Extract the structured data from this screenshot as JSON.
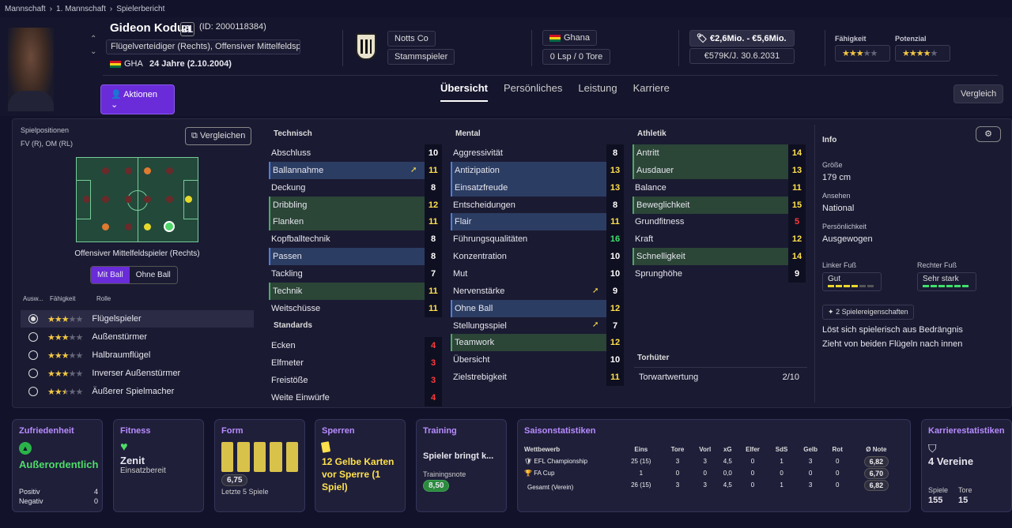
{
  "breadcrumb": [
    "Mannschaft",
    "1. Mannschaft",
    "Spielerbericht"
  ],
  "player": {
    "name": "Gideon Kodua",
    "number": "21",
    "id": "(ID: 2000118384)",
    "positions": "Flügelverteidiger (Rechts), Offensiver Mittelfeldsp...",
    "nation": "GHA",
    "age": "24 Jahre (2.10.2004)"
  },
  "club": {
    "name": "Notts Co",
    "role": "Stammspieler"
  },
  "country": {
    "name": "Ghana",
    "caps": "0 Lsp / 0 Tore"
  },
  "value": {
    "range": "€2,6Mio. - €5,6Mio.",
    "contract": "€579K/J. 30.6.2031"
  },
  "ability": {
    "label": "Fähigkeit",
    "stars": 2.5,
    "potential_label": "Potenzial",
    "potential_stars": 4
  },
  "actions_label": "Aktionen",
  "tabs": [
    "Übersicht",
    "Persönliches",
    "Leistung",
    "Karriere"
  ],
  "compare_label": "Vergleich",
  "positions_panel": {
    "title": "Spielpositionen",
    "value": "FV (R), OM (RL)",
    "compare_btn": "Vergleichen",
    "role_name": "Offensiver Mittelfeldspieler (Rechts)",
    "with_ball": "Mit Ball",
    "without_ball": "Ohne Ball",
    "col_select": "Ausw...",
    "col_ability": "Fähigkeit",
    "col_role": "Rolle",
    "roles": [
      {
        "name": "Flügelspieler",
        "stars": 3,
        "selected": true
      },
      {
        "name": "Außenstürmer",
        "stars": 3
      },
      {
        "name": "Halbraumflügel",
        "stars": 3
      },
      {
        "name": "Inverser Außenstürmer",
        "stars": 3
      },
      {
        "name": "Äußerer Spielmacher",
        "stars": 2.5
      }
    ]
  },
  "technical": {
    "title": "Technisch",
    "rows": [
      [
        "Abschluss",
        "10",
        ""
      ],
      [
        "Ballannahme",
        "11",
        "blue"
      ],
      [
        "Deckung",
        "8",
        ""
      ],
      [
        "Dribbling",
        "12",
        "green"
      ],
      [
        "Flanken",
        "11",
        "green"
      ],
      [
        "Kopfballtechnik",
        "8",
        ""
      ],
      [
        "Passen",
        "8",
        "blue"
      ],
      [
        "Tackling",
        "7",
        ""
      ],
      [
        "Technik",
        "11",
        "green"
      ],
      [
        "Weitschüsse",
        "11",
        ""
      ]
    ]
  },
  "standards": {
    "title": "Standards",
    "rows": [
      [
        "Ecken",
        "4",
        ""
      ],
      [
        "Elfmeter",
        "3",
        ""
      ],
      [
        "Freistöße",
        "3",
        ""
      ],
      [
        "Weite Einwürfe",
        "4",
        ""
      ]
    ]
  },
  "mental": {
    "title": "Mental",
    "rows": [
      [
        "Aggressivität",
        "8",
        ""
      ],
      [
        "Antizipation",
        "13",
        "blue"
      ],
      [
        "Einsatzfreude",
        "13",
        "blue"
      ],
      [
        "Entscheidungen",
        "8",
        ""
      ],
      [
        "Flair",
        "11",
        "blue"
      ],
      [
        "Führungsqualitäten",
        "16",
        ""
      ],
      [
        "Konzentration",
        "10",
        ""
      ],
      [
        "Mut",
        "10",
        ""
      ],
      [
        "Nervenstärke",
        "9",
        ""
      ],
      [
        "Ohne Ball",
        "12",
        "blue"
      ],
      [
        "Stellungsspiel",
        "7",
        ""
      ],
      [
        "Teamwork",
        "12",
        "green"
      ],
      [
        "Übersicht",
        "10",
        ""
      ],
      [
        "Zielstrebigkeit",
        "11",
        ""
      ]
    ]
  },
  "athletic": {
    "title": "Athletik",
    "rows": [
      [
        "Antritt",
        "14",
        "green"
      ],
      [
        "Ausdauer",
        "13",
        "green"
      ],
      [
        "Balance",
        "11",
        ""
      ],
      [
        "Beweglichkeit",
        "15",
        "green"
      ],
      [
        "Grundfitness",
        "5",
        ""
      ],
      [
        "Kraft",
        "12",
        ""
      ],
      [
        "Schnelligkeit",
        "14",
        "green"
      ],
      [
        "Sprunghöhe",
        "9",
        ""
      ]
    ]
  },
  "keeper": {
    "title": "Torhüter",
    "label": "Torwartwertung",
    "value": "2/10"
  },
  "info": {
    "title": "Info",
    "height_label": "Größe",
    "height": "179 cm",
    "reputation_label": "Ansehen",
    "reputation": "National",
    "personality_label": "Persönlichkeit",
    "personality": "Ausgewogen",
    "left_foot_label": "Linker Fuß",
    "left_foot": "Gut",
    "right_foot_label": "Rechter Fuß",
    "right_foot": "Sehr stark",
    "traits_btn": "2 Spielereigenschaften",
    "traits": [
      "Löst sich spielerisch aus Bedrängnis",
      "Zieht von beiden Flügeln nach innen"
    ]
  },
  "cards": {
    "morale": {
      "title": "Zufriedenheit",
      "value": "Außerordentlich",
      "pos_label": "Positiv",
      "pos": "4",
      "neg_label": "Negativ",
      "neg": "0"
    },
    "fitness": {
      "title": "Fitness",
      "value": "Zenit",
      "sub": "Einsatzbereit"
    },
    "form": {
      "title": "Form",
      "rating": "6,75",
      "sub": "Letzte 5 Spiele"
    },
    "bans": {
      "title": "Sperren",
      "text": "12 Gelbe Karten vor Sperre (1 Spiel)"
    },
    "training": {
      "title": "Training",
      "text": "Spieler bringt k...",
      "note_label": "Trainingsnote",
      "note": "8,50"
    },
    "season": {
      "title": "Saisonstatistiken",
      "headers": [
        "Wettbewerb",
        "Eins",
        "Tore",
        "Vorl",
        "xG",
        "Elfer",
        "SdS",
        "Gelb",
        "Rot",
        "Ø Note"
      ],
      "rows": [
        [
          "EFL Championship",
          "25 (15)",
          "3",
          "3",
          "4,5",
          "0",
          "1",
          "3",
          "0",
          "6,82"
        ],
        [
          "FA Cup",
          "1",
          "0",
          "0",
          "0,0",
          "0",
          "0",
          "0",
          "0",
          "6,70"
        ],
        [
          "Gesamt (Verein)",
          "26 (15)",
          "3",
          "3",
          "4,5",
          "0",
          "1",
          "3",
          "0",
          "6,82"
        ]
      ]
    },
    "career": {
      "title": "Karrierestatistiken",
      "clubs": "4 Vereine",
      "apps_label": "Spiele",
      "apps": "155",
      "goals_label": "Tore",
      "goals": "15"
    }
  }
}
